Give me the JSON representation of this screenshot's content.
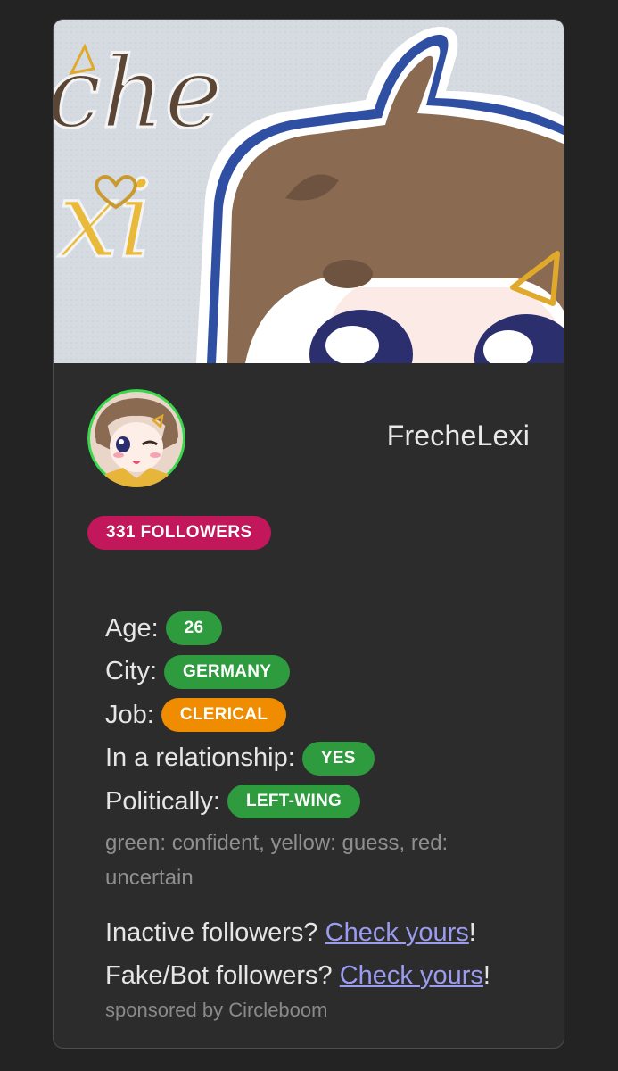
{
  "banner": {
    "alt_art": "anime banner art",
    "script_text": [
      "che",
      "xi"
    ]
  },
  "profile": {
    "username": "FrecheLexi",
    "followers_label": "331 FOLLOWERS"
  },
  "info": {
    "age": {
      "label": "Age:",
      "value": "26",
      "color": "#2e9b3f"
    },
    "city": {
      "label": "City:",
      "value": "GERMANY",
      "color": "#2e9b3f"
    },
    "job": {
      "label": "Job:",
      "value": "CLERICAL",
      "color": "#f08c00"
    },
    "relationship": {
      "label": "In a relationship:",
      "value": "YES",
      "color": "#2e9b3f"
    },
    "politics": {
      "label": "Politically:",
      "value": "LEFT-WING",
      "color": "#2e9b3f"
    }
  },
  "legend": "green: confident, yellow: guess, red: uncertain",
  "links": {
    "inactive_prefix": "Inactive followers? ",
    "inactive_link": "Check yours",
    "inactive_suffix": "!",
    "fake_prefix": "Fake/Bot followers? ",
    "fake_link": "Check yours",
    "fake_suffix": "!"
  },
  "sponsored": "sponsored by Circleboom",
  "colors": {
    "followers_badge": "#c2185b",
    "green": "#2e9b3f",
    "orange": "#f08c00",
    "link": "#9b9bf0"
  }
}
